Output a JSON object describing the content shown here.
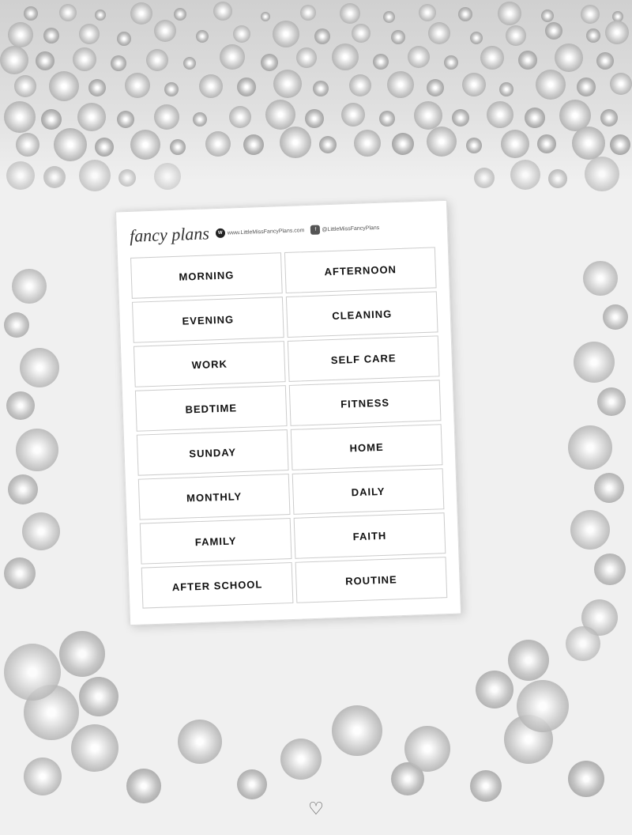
{
  "background": {
    "color": "#f2f2f2"
  },
  "brand": {
    "logo": "fancy plans",
    "website_icon": "W",
    "website_text": "www.LittleMissFancyPlans.com",
    "social_icon": "f",
    "social_text": "@LittleMissFancyPlans"
  },
  "stickers": {
    "left_column": [
      "MORNING",
      "EVENING",
      "WORK",
      "BEDTIME",
      "SUNDAY",
      "MONTHLY",
      "FAMILY",
      "AFTER SCHOOL"
    ],
    "right_column": [
      "AFTERNOON",
      "CLEANING",
      "SELF CARE",
      "FITNESS",
      "HOME",
      "DAILY",
      "FAITH",
      "ROUTINE"
    ]
  },
  "footer": {
    "signature": "♡"
  }
}
